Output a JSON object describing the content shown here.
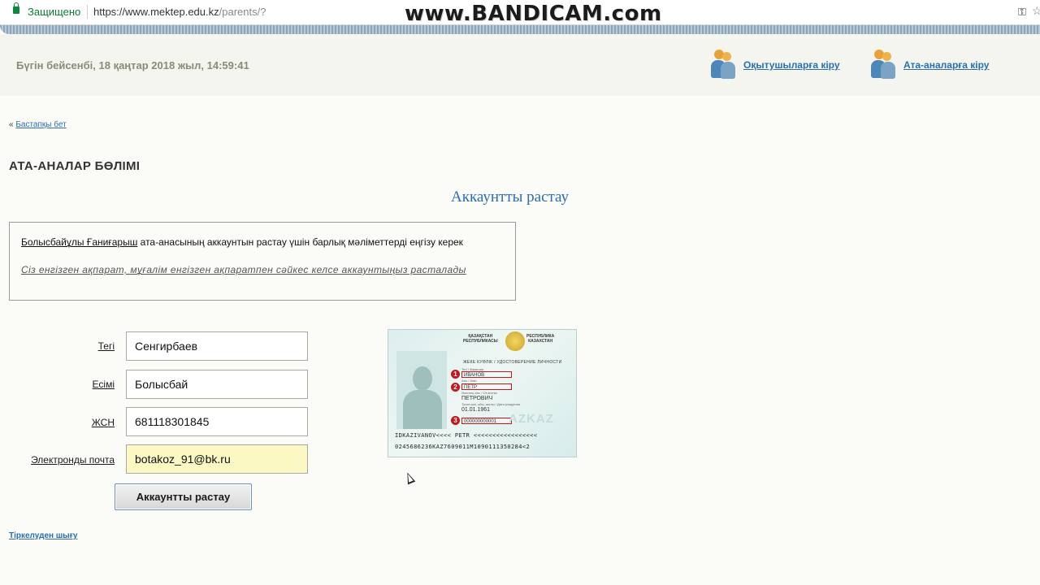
{
  "browser": {
    "secure_label": "Защищено",
    "url_base": "https://www.mektep.edu.kz",
    "url_path": "/parents/?",
    "watermark": "www.BANDICAM.com"
  },
  "header": {
    "date_text": "Бүгін бейсенбі, 18 қаңтар 2018 жыл, 14:59:41",
    "teacher_login": "Оқытушыларға кіру",
    "parent_login": "Ата-аналарға кіру"
  },
  "breadcrumb": {
    "prefix": "«",
    "home_link": "Бастапқы бет"
  },
  "section_title": "АТА-АНАЛАР БӨЛІМІ",
  "page_heading": "Аккаунтты растау",
  "info": {
    "student_name": "Болысбайұлы Ғаниғарыш",
    "message": " ата-анасының аккаунтын растау үшін барлық мәліметтерді еңгізу керек",
    "note": "Сіз енгізген ақпарат, мұғалім енгізген ақпаратпен сәйкес келсе аккаунтыңыз расталады"
  },
  "form": {
    "surname_label": "Тегі",
    "surname_value": "Сенгирбаев",
    "name_label": "Есімі",
    "name_value": "Болысбай",
    "iin_label": "ЖСН",
    "iin_value": "681118301845",
    "email_label": "Электронды почта",
    "email_value": "botakoz_91@bk.ru",
    "submit_label": "Аккаунтты растау"
  },
  "logout_link": "Тіркелуден шығу",
  "id_card": {
    "header_left": "ҚАЗАҚСТАН\nРЕСПУБЛИКАСЫ",
    "header_right": "РЕСПУБЛИКА\nКАЗАХСТАН",
    "title": "ЖЕКЕ КУӘЛІК / УДОСТОВЕРЕНИЕ ЛИЧНОСТИ",
    "label_surname": "Тегі / Фамилия",
    "label_name": "Аты / Имя",
    "label_patronymic": "Әкесінің аты / Отчество",
    "label_birth": "Туған күні, айы, жылы / Дата рождения",
    "surname": "ИВАНОВ",
    "name": "ПЕТР",
    "patronymic": "ПЕТРОВИЧ",
    "birth_date": "01.01.1961",
    "iin": "000000000001",
    "badge1": "1",
    "badge2": "2",
    "badge3": "3",
    "watermark": "AZKAZ",
    "mrz_line1": "IDKAZIVANOV<<<< PETR <<<<<<<<<<<<<<<<<",
    "mrz_line2": "0245686236KAZ7609011M1090111350284<2"
  },
  "colors": {
    "link": "#2a6fb0",
    "badge": "#c4171b",
    "email_field_bg": "#fbf8c4"
  }
}
